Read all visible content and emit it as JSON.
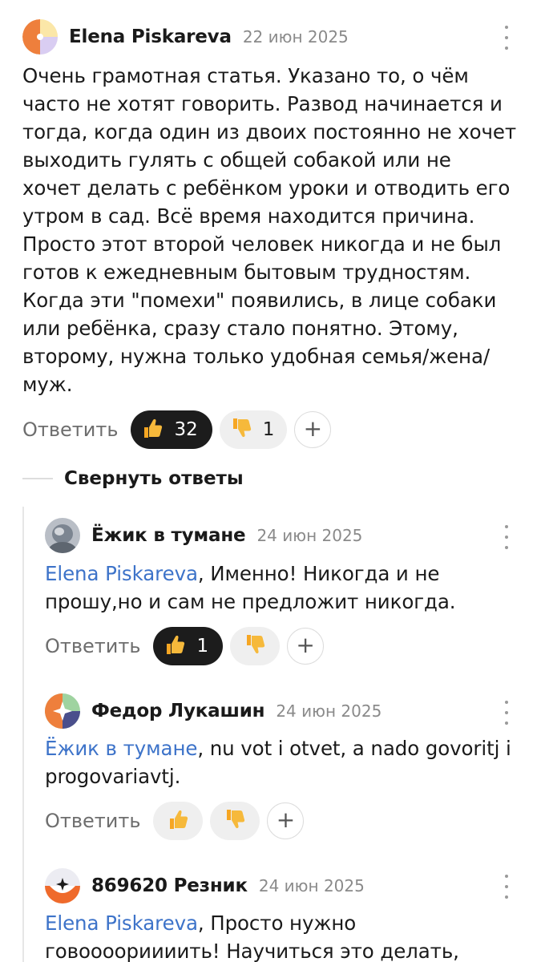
{
  "comments": [
    {
      "author": "Elena Piskareva",
      "date": "22 июн 2025",
      "lines": [
        "Очень грамотная статья. Указано то, о чём",
        "часто не хотят говорить. Развод начинается и",
        "тогда, когда один из двоих постоянно не хочет",
        "выходить гулять с общей собакой или не",
        "хочет делать с ребёнком уроки и отводить его",
        "утром в сад. Всё время находится причина.",
        "Просто этот второй человек никогда и не был",
        "готов к ежедневным бытовым трудностям.",
        "Когда эти \"помехи\" появились, в лице собаки",
        "или ребёнка, сразу стало понятно. Этому,",
        "второму, нужна только удобная семья/жена/",
        "муж."
      ],
      "reply_label": "Ответить",
      "likes": "32",
      "dislikes": "1"
    },
    {
      "author": "Ёжик в тумане",
      "date": "24 июн 2025",
      "mention": "Elena Piskareva",
      "line1_rest": ", Именно! Никогда и не",
      "line2": "прошу,но и сам не предложит никогда.",
      "reply_label": "Ответить",
      "likes": "1"
    },
    {
      "author": "Федор Лукашин",
      "date": "24 июн 2025",
      "mention": "Ёжик в тумане",
      "line1_rest": ", nu vot i otvet, a nado govoritj i",
      "line2": "progovariavtj.",
      "reply_label": "Ответить"
    },
    {
      "author": "869620 Резник",
      "date": "24 июн 2025",
      "mention": "Elena Piskareva",
      "line1_rest": ", Просто нужно",
      "line2": "говоооориииить! Научиться это делать,"
    }
  ],
  "collapse_label": "Свернуть ответы",
  "icons": {
    "like": "thumbs-up-icon",
    "dislike": "thumbs-down-icon",
    "add_reaction": "plus-icon",
    "more": "more-vertical-icon"
  },
  "colors": {
    "mention": "#3d73c9",
    "dark_pill": "#1c1c1c",
    "light_pill": "#efefef",
    "muted": "#8a8a8a"
  }
}
